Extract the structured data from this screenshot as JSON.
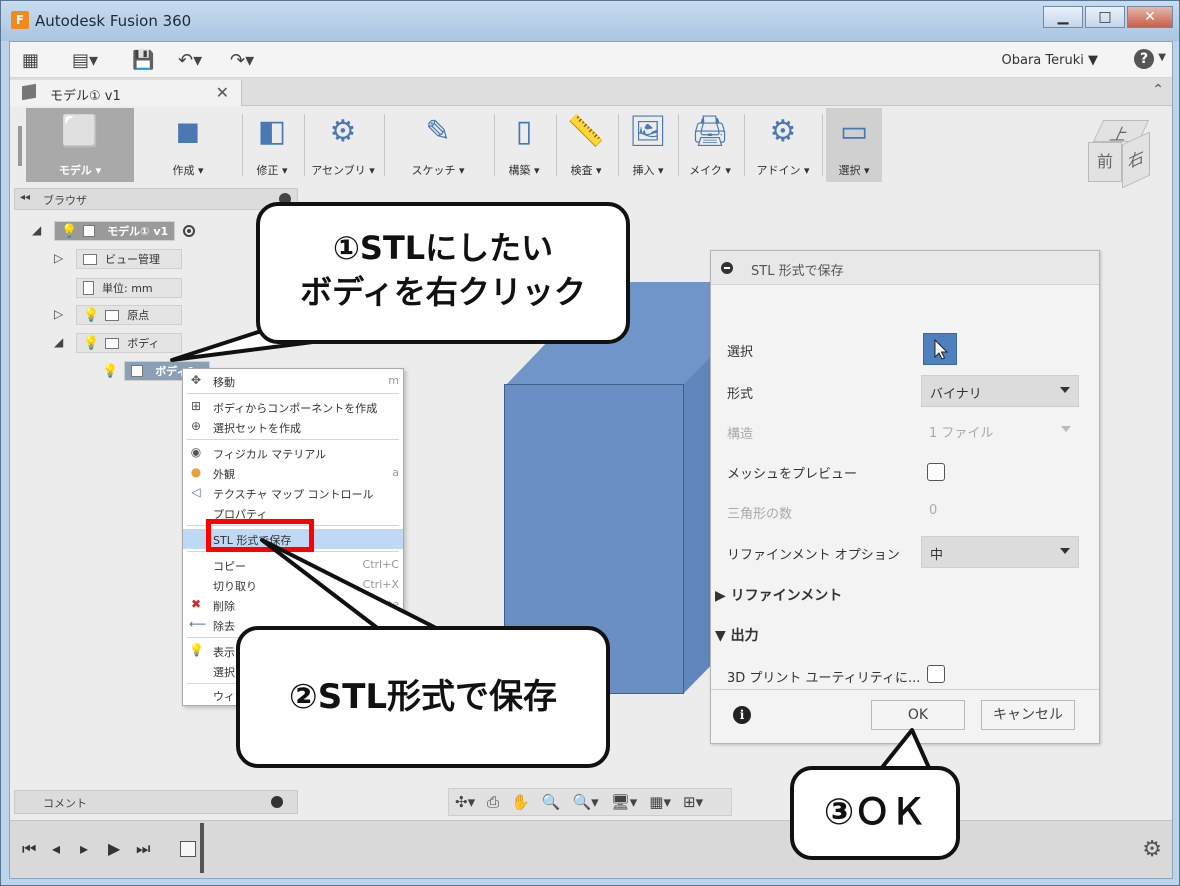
{
  "app": {
    "logo": "F",
    "title": "Autodesk Fusion 360",
    "win_minimize": "▁",
    "win_maximize": "□",
    "win_close": "✕"
  },
  "toolbar": {
    "user": "Obara Teruki ▼",
    "help": "?",
    "help_caret": "▼"
  },
  "document_tab": {
    "label": "モデル① v1",
    "close": "✕",
    "collapse": "⌃"
  },
  "ribbon": {
    "groups": [
      {
        "label": "モデル ▾",
        "glyph": "⬜"
      },
      {
        "label": "作成 ▾",
        "glyph": "◼"
      },
      {
        "label": "修正 ▾",
        "glyph": "◧"
      },
      {
        "label": "アセンブリ ▾",
        "glyph": "⚙"
      },
      {
        "label": "スケッチ ▾",
        "glyph": "✎"
      },
      {
        "label": "構築 ▾",
        "glyph": "▯"
      },
      {
        "label": "検査 ▾",
        "glyph": "📏"
      },
      {
        "label": "挿入 ▾",
        "glyph": "🖼"
      },
      {
        "label": "メイク ▾",
        "glyph": "🖨"
      },
      {
        "label": "アドイン ▾",
        "glyph": "⚙"
      },
      {
        "label": "選択 ▾",
        "glyph": "▭"
      }
    ]
  },
  "viewcube": {
    "top": "上",
    "front": "前",
    "right": "右"
  },
  "browser": {
    "arrows": "◂◂",
    "title": "ブラウザ",
    "root": "モデル① v1",
    "items": [
      {
        "label": "ビュー管理",
        "toggle": "▷"
      },
      {
        "label": "単位: mm",
        "toggle": ""
      },
      {
        "label": "原点",
        "toggle": "▷"
      },
      {
        "label": "ボディ",
        "toggle": "◢"
      }
    ],
    "selected_body": "ボディ1"
  },
  "context_menu": {
    "items": [
      {
        "icon": "✥",
        "label": "移動",
        "shortcut": "m"
      },
      {
        "icon": "⊞",
        "label": "ボディからコンポーネントを作成",
        "shortcut": ""
      },
      {
        "icon": "⊕",
        "label": "選択セットを作成",
        "shortcut": ""
      },
      {
        "icon": "◉",
        "label": "フィジカル マテリアル",
        "shortcut": ""
      },
      {
        "icon": "●",
        "label": "外観",
        "shortcut": "a"
      },
      {
        "icon": "◁",
        "label": "テクスチャ マップ コントロール",
        "shortcut": ""
      },
      {
        "icon": "",
        "label": "プロパティ",
        "shortcut": ""
      },
      {
        "icon": "",
        "label": "STL 形式で保存",
        "shortcut": ""
      },
      {
        "icon": "",
        "label": "コピー",
        "shortcut": "Ctrl+C"
      },
      {
        "icon": "",
        "label": "切り取り",
        "shortcut": "Ctrl+X"
      },
      {
        "icon": "✖",
        "label": "削除",
        "shortcut": "Delete"
      },
      {
        "icon": "⟵",
        "label": "除去",
        "shortcut": ""
      },
      {
        "icon": "💡",
        "label": "表示",
        "shortcut": ""
      },
      {
        "icon": "",
        "label": "選択",
        "shortcut": ""
      },
      {
        "icon": "",
        "label": "ウィン",
        "shortcut": ""
      }
    ]
  },
  "dialog": {
    "title": "STL 形式で保存",
    "select_label": "選択",
    "format_label": "形式",
    "format_value": "バイナリ",
    "structure_label": "構造",
    "structure_value": "1 ファイル",
    "preview_label": "メッシュをプレビュー",
    "triangles_label": "三角形の数",
    "triangles_value": "0",
    "refine_option_label": "リファインメント オプション",
    "refine_option_value": "中",
    "refinement_section": "▶ リファインメント",
    "output_section": "▼ 出力",
    "print_utility_label": "3D プリント ユーティリティに...",
    "ok": "OK",
    "cancel": "キャンセル",
    "info": "i"
  },
  "comments": {
    "title": "コメント"
  },
  "nav": {
    "icons": [
      "✣▾",
      "⎙",
      "✋",
      "🔍",
      "🔍▾",
      "🖥▾",
      "▦▾",
      "⊞▾"
    ]
  },
  "timeline": {
    "controls": [
      "⏮",
      "◂",
      "▸",
      "▶",
      "⏭"
    ],
    "settings": "⚙"
  },
  "annotations": {
    "step1_line1": "①STLにしたい",
    "step1_line2": "ボディを右クリック",
    "step2": "②STL形式で保存",
    "step3": "③ＯＫ"
  }
}
